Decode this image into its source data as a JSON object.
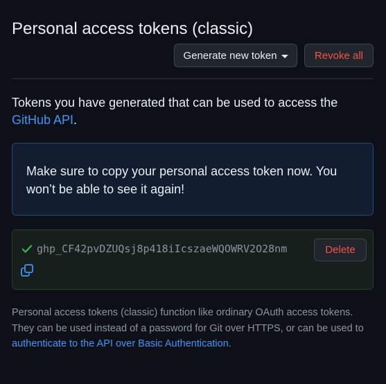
{
  "header": {
    "title": "Personal access tokens (classic)",
    "generate_label": "Generate new token",
    "revoke_label": "Revoke all"
  },
  "intro": {
    "text": "Tokens you have generated that can be used to access the ",
    "link_text": "GitHub API",
    "suffix": "."
  },
  "flash": {
    "message": "Make sure to copy your personal access token now. You won’t be able to see it again!"
  },
  "token": {
    "value": "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",
    "delete_label": "Delete",
    "status_icon": "check-icon",
    "copy_icon": "copy-icon"
  },
  "footer": {
    "text": "Personal access tokens (classic) function like ordinary OAuth access tokens. They can be used instead of a password for Git over HTTPS, or can be used to ",
    "link_text": "authenticate to the API over Basic Authentication",
    "suffix": "."
  },
  "colors": {
    "background": "#0d1117",
    "link": "#4493f8",
    "danger": "#f85149",
    "success": "#3fb950",
    "muted": "#8b949e"
  }
}
